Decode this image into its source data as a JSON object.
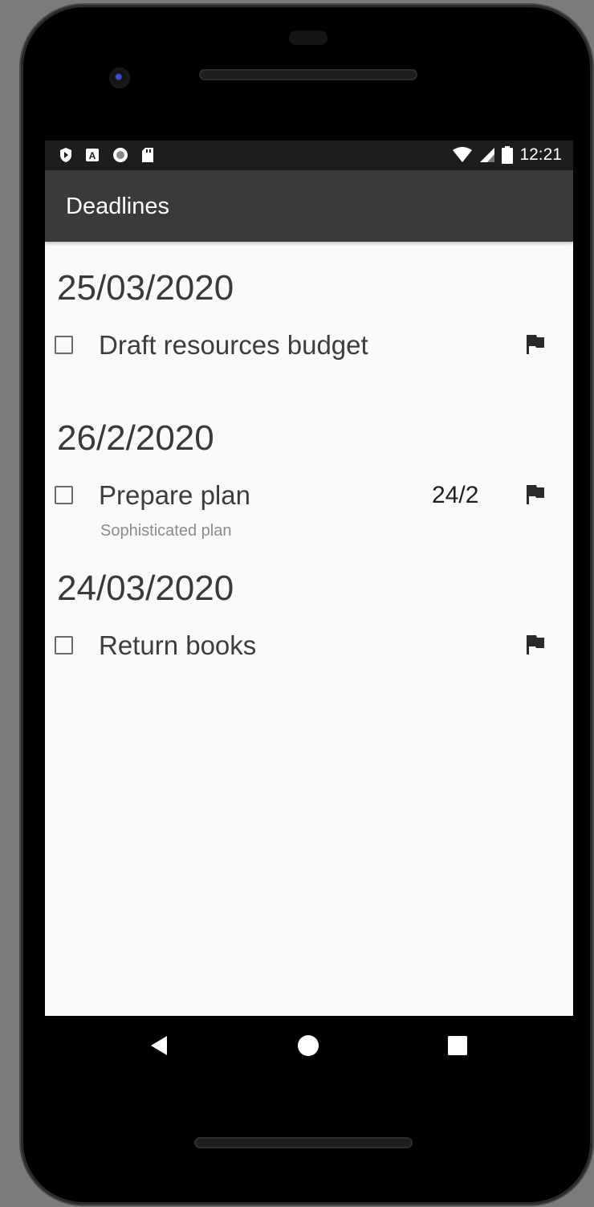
{
  "status_bar": {
    "time": "12:21",
    "left_icons": [
      "shield-icon",
      "a-badge-icon",
      "circle-notification-icon",
      "sd-card-icon"
    ],
    "right_icons": [
      "wifi-icon",
      "signal-icon",
      "battery-icon"
    ]
  },
  "app_bar": {
    "title": "Deadlines"
  },
  "groups": [
    {
      "date": "25/03/2020",
      "tasks": [
        {
          "title": "Draft resources budget",
          "subtitle": "",
          "due": "",
          "flag_icon": "flag-icon",
          "checked": false
        }
      ]
    },
    {
      "date": "26/2/2020",
      "tasks": [
        {
          "title": "Prepare plan",
          "subtitle": "Sophisticated plan",
          "due": "24/2",
          "flag_icon": "flag-icon",
          "checked": false
        }
      ]
    },
    {
      "date": "24/03/2020",
      "tasks": [
        {
          "title": "Return books",
          "subtitle": "",
          "due": "",
          "flag_icon": "flag-icon",
          "checked": false
        }
      ]
    }
  ],
  "nav_bar": {
    "buttons": [
      "back-icon",
      "home-icon",
      "recents-icon"
    ]
  }
}
